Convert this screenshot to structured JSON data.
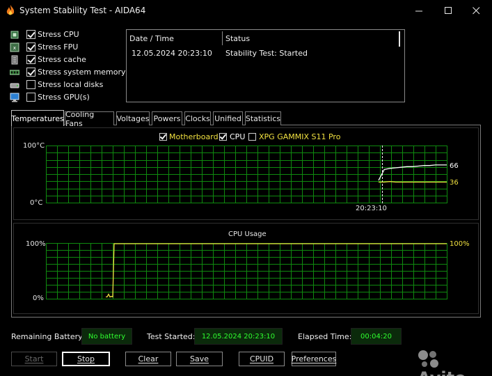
{
  "window": {
    "title": "System Stability Test - AIDA64",
    "min_glyph": "—",
    "max_glyph": "☐",
    "close_glyph": "✕"
  },
  "stress": [
    {
      "label": "Stress CPU",
      "checked": true,
      "icon": "cpu-chip-icon"
    },
    {
      "label": "Stress FPU",
      "checked": true,
      "icon": "fpu-chip-icon"
    },
    {
      "label": "Stress cache",
      "checked": true,
      "icon": "cache-icon"
    },
    {
      "label": "Stress system memory",
      "checked": true,
      "icon": "memory-icon"
    },
    {
      "label": "Stress local disks",
      "checked": false,
      "icon": "disk-icon"
    },
    {
      "label": "Stress GPU(s)",
      "checked": false,
      "icon": "monitor-icon"
    }
  ],
  "status_table": {
    "headers": [
      "Date / Time",
      "Status"
    ],
    "rows": [
      [
        "12.05.2024 20:23:10",
        "Stability Test: Started"
      ]
    ]
  },
  "tabs": [
    "Temperatures",
    "Cooling Fans",
    "Voltages",
    "Powers",
    "Clocks",
    "Unified",
    "Statistics"
  ],
  "active_tab": "Temperatures",
  "temp_chart": {
    "legend": [
      {
        "label": "Motherboard",
        "checked": true,
        "color": "#f0e040"
      },
      {
        "label": "CPU",
        "checked": true,
        "color": "#ffffff"
      },
      {
        "label": "XPG GAMMIX S11 Pro",
        "checked": false,
        "color": "#f0e040"
      }
    ],
    "y_top": "100°C",
    "y_bottom": "0°C",
    "time_label": "20:23:10",
    "cpu_value": "66",
    "mb_value": "36"
  },
  "usage_chart": {
    "title": "CPU Usage",
    "y_top": "100%",
    "y_bottom": "0%",
    "value_label": "100%"
  },
  "chart_data": [
    {
      "type": "line",
      "ylim": [
        0,
        100
      ],
      "series": [
        {
          "name": "Motherboard",
          "color": "#f0e040",
          "values": [
            36,
            36,
            37,
            36,
            36,
            36,
            36,
            36,
            36,
            36,
            36,
            36,
            36
          ]
        },
        {
          "name": "CPU",
          "color": "#ffffff",
          "values": [
            39,
            58,
            60,
            61,
            62,
            63,
            63,
            64,
            65,
            65,
            66,
            66,
            66
          ]
        }
      ]
    },
    {
      "type": "line",
      "title": "CPU Usage",
      "ylim": [
        0,
        100
      ],
      "series": [
        {
          "values": [
            2,
            2,
            7,
            2,
            3,
            2,
            100,
            100,
            100,
            100,
            100,
            100,
            100,
            100,
            100,
            100,
            100,
            100,
            100,
            100,
            100,
            100,
            100,
            100,
            100,
            100,
            100,
            100,
            100,
            100,
            100,
            100,
            100,
            100,
            100,
            100,
            100,
            100,
            100,
            100,
            100,
            100,
            100,
            100,
            100,
            100,
            100,
            100,
            100,
            100,
            100,
            100,
            100,
            100,
            100,
            100,
            100,
            100,
            100,
            100
          ]
        }
      ]
    }
  ],
  "info": {
    "battery_label": "Remaining Battery:",
    "battery_value": "No battery",
    "started_label": "Test Started:",
    "started_value": "12.05.2024 20:23:10",
    "elapsed_label": "Elapsed Time:",
    "elapsed_value": "00:04:20"
  },
  "buttons": {
    "start": "Start",
    "stop": "Stop",
    "clear": "Clear",
    "save": "Save",
    "cpuid": "CPUID",
    "preferences": "Preferences"
  },
  "watermark": "Avito",
  "colors": {
    "grid": "#0f8a0f",
    "grid_bg": "#000000",
    "info_text": "#2fff2f"
  }
}
